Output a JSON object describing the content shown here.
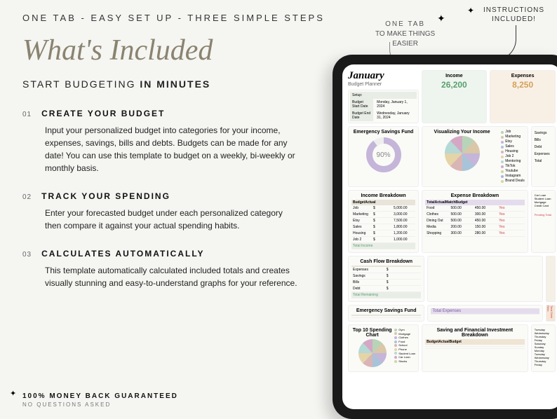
{
  "topline": "ONE TAB - EASY SET UP - THREE SIMPLE STEPS",
  "callout1": {
    "l1": "ONE TAB",
    "l2": "TO MAKE THINGS",
    "l3": "EASIER"
  },
  "callout2": {
    "l1": "INSTRUCTIONS",
    "l2": "INCLUDED!"
  },
  "title": "What's Included",
  "subtitle": {
    "pre": "START BUDGETING ",
    "bold": "IN MINUTES"
  },
  "steps": [
    {
      "num": "01",
      "title": "CREATE YOUR BUDGET",
      "body": "Input your personalized budget into categories for your income, expenses, savings, bills and debts. Budgets can be made for any date! You can use this template to budget on a weekly, bi-weekly or monthly basis."
    },
    {
      "num": "02",
      "title": "TRACK YOUR SPENDING",
      "body": "Enter your forecasted budget under each personalized category then compare it against your actual spending habits."
    },
    {
      "num": "03",
      "title": "CALCULATES AUTOMATICALLY",
      "body": "This template automatically calculated included totals and creates visually stunning and easy-to-understand graphs for your reference."
    }
  ],
  "guarantee": {
    "l1": "100% MONEY BACK GUARANTEED",
    "l2": "NO QUESTIONS ASKED"
  },
  "sheet": {
    "month": "January",
    "planner": "Budget Planner",
    "setup": {
      "h": "Setup:",
      "r1a": "Budget Start Date",
      "r1b": "Monday, January 1, 2024",
      "r2a": "Budget End Date",
      "r2b": "Wednesday, January 31, 2024"
    },
    "income": {
      "label": "Income",
      "val": "26,200"
    },
    "expenses": {
      "label": "Expenses",
      "val": "8,250"
    },
    "emergency": {
      "h": "Emergency Savings Fund",
      "pct": "90%"
    },
    "visualize": {
      "h": "Visualizing Your Income",
      "items": [
        "Job",
        "Marketing",
        "Etsy",
        "Sales",
        "Housing",
        "Job 2",
        "Mentoring",
        "TikTok",
        "Youtube",
        "Instagram",
        "Brand Deals"
      ]
    },
    "sidecats": [
      "Savings",
      "Bills",
      "Debt",
      "Expenses",
      "Total"
    ],
    "incomeBreak": {
      "h": "Income Breakdown",
      "cols": [
        "",
        "Budget",
        "Actual"
      ],
      "rows": [
        [
          "Job",
          "$",
          "5,000.00"
        ],
        [
          "Marketing",
          "$",
          "3,000.00"
        ],
        [
          "Etsy",
          "$",
          "7,500.00"
        ],
        [
          "Sales",
          "$",
          "1,800.00"
        ],
        [
          "Housing",
          "$",
          "1,200.00"
        ],
        [
          "Job 2",
          "$",
          "1,000.00"
        ]
      ],
      "total": "Total Income"
    },
    "expenseBreak": {
      "h": "Expense Breakdown",
      "rows": [
        [
          "Food",
          "500.00",
          "450.00",
          "Yes"
        ],
        [
          "Clothes",
          "500.00",
          "300.00",
          "Yes"
        ],
        [
          "Dining Out",
          "500.00",
          "450.00",
          "Yes"
        ],
        [
          "Media",
          "200.00",
          "150.00",
          "Yes"
        ],
        [
          "Shopping",
          "300.00",
          "280.00",
          "Yes"
        ]
      ]
    },
    "cashflow": {
      "h": "Cash Flow Breakdown",
      "rows": [
        [
          "Expenses",
          "$"
        ],
        [
          "Savings",
          "$"
        ],
        [
          "Bills",
          "$"
        ],
        [
          "Debt",
          "$"
        ],
        [
          "Remaining",
          "$"
        ]
      ],
      "total": "Total Remaining"
    },
    "emergency2": "Emergency Savings Fund",
    "topspend": "Top 10 Spending Chart",
    "spendItems": [
      "Gym",
      "Mortgage",
      "Clothes",
      "Food",
      "School",
      "Phone",
      "Student Loan",
      "Car Loan",
      "Stocks"
    ],
    "totalExp": "Total Expenses",
    "saving": {
      "h": "Saving and Financial Investment Breakdown",
      "cols": [
        "",
        "Budget",
        "Actual",
        "Budget"
      ]
    },
    "debtcol": [
      "Car Loan",
      "Student Loan",
      "Mortgage",
      "Credit Card"
    ],
    "pending": "Pending Total",
    "totalDebt": "Total Debt Rem",
    "days": [
      "Tuesday",
      "Wednesday",
      "Thursday",
      "Friday",
      "Saturday",
      "Sunday",
      "Monday",
      "Tuesday",
      "Wednesday",
      "Thursday",
      "Friday"
    ]
  }
}
